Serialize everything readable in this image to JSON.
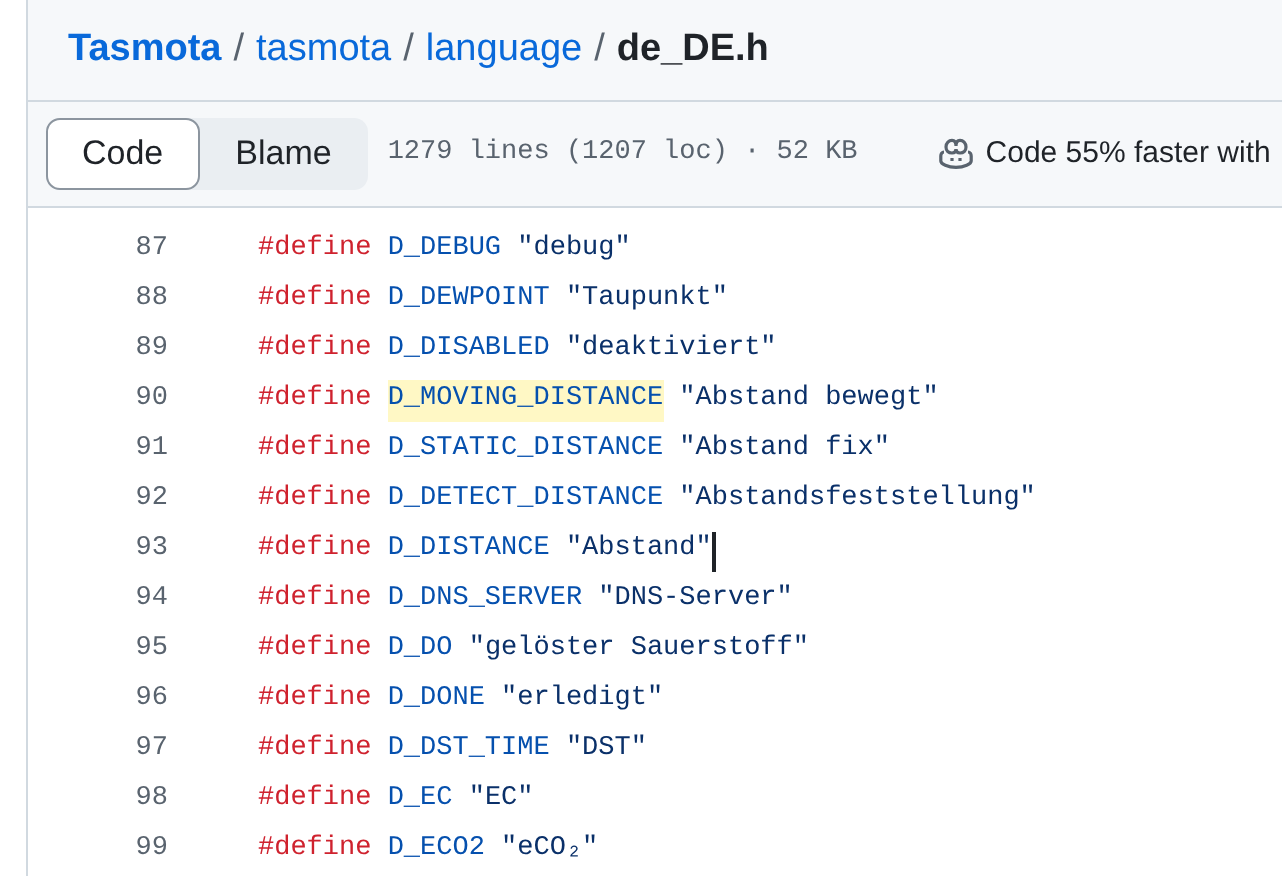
{
  "breadcrumb": [
    {
      "label": "Tasmota",
      "kind": "owner"
    },
    {
      "label": "tasmota",
      "kind": "link"
    },
    {
      "label": "language",
      "kind": "link"
    },
    {
      "label": "de_DE.h",
      "kind": "current"
    }
  ],
  "separator": "/",
  "view_tabs": [
    {
      "label": "Code",
      "selected": true
    },
    {
      "label": "Blame",
      "selected": false
    }
  ],
  "file_info": "1279 lines (1207 loc) · 52 KB",
  "copilot_promo": "Code 55% faster with",
  "lines": [
    {
      "number": "87",
      "keyword": "#define",
      "macro": "D_DEBUG",
      "value": "\"debug\"",
      "highlighted": false,
      "cursor": false
    },
    {
      "number": "88",
      "keyword": "#define",
      "macro": "D_DEWPOINT",
      "value": "\"Taupunkt\"",
      "highlighted": false,
      "cursor": false
    },
    {
      "number": "89",
      "keyword": "#define",
      "macro": "D_DISABLED",
      "value": "\"deaktiviert\"",
      "highlighted": false,
      "cursor": false
    },
    {
      "number": "90",
      "keyword": "#define",
      "macro": "D_MOVING_DISTANCE",
      "value": "\"Abstand bewegt\"",
      "highlighted": true,
      "cursor": false
    },
    {
      "number": "91",
      "keyword": "#define",
      "macro": "D_STATIC_DISTANCE",
      "value": "\"Abstand fix\"",
      "highlighted": false,
      "cursor": false
    },
    {
      "number": "92",
      "keyword": "#define",
      "macro": "D_DETECT_DISTANCE",
      "value": "\"Abstandsfeststellung\"",
      "highlighted": false,
      "cursor": false
    },
    {
      "number": "93",
      "keyword": "#define",
      "macro": "D_DISTANCE",
      "value": "\"Abstand\"",
      "highlighted": false,
      "cursor": true
    },
    {
      "number": "94",
      "keyword": "#define",
      "macro": "D_DNS_SERVER",
      "value": "\"DNS-Server\"",
      "highlighted": false,
      "cursor": false
    },
    {
      "number": "95",
      "keyword": "#define",
      "macro": "D_DO",
      "value": "\"gelöster Sauerstoff\"",
      "highlighted": false,
      "cursor": false
    },
    {
      "number": "96",
      "keyword": "#define",
      "macro": "D_DONE",
      "value": "\"erledigt\"",
      "highlighted": false,
      "cursor": false
    },
    {
      "number": "97",
      "keyword": "#define",
      "macro": "D_DST_TIME",
      "value": "\"DST\"",
      "highlighted": false,
      "cursor": false
    },
    {
      "number": "98",
      "keyword": "#define",
      "macro": "D_EC",
      "value": "\"EC\"",
      "highlighted": false,
      "cursor": false
    },
    {
      "number": "99",
      "keyword": "#define",
      "macro": "D_ECO2",
      "value": "\"eCO₂\"",
      "highlighted": false,
      "cursor": false
    }
  ]
}
